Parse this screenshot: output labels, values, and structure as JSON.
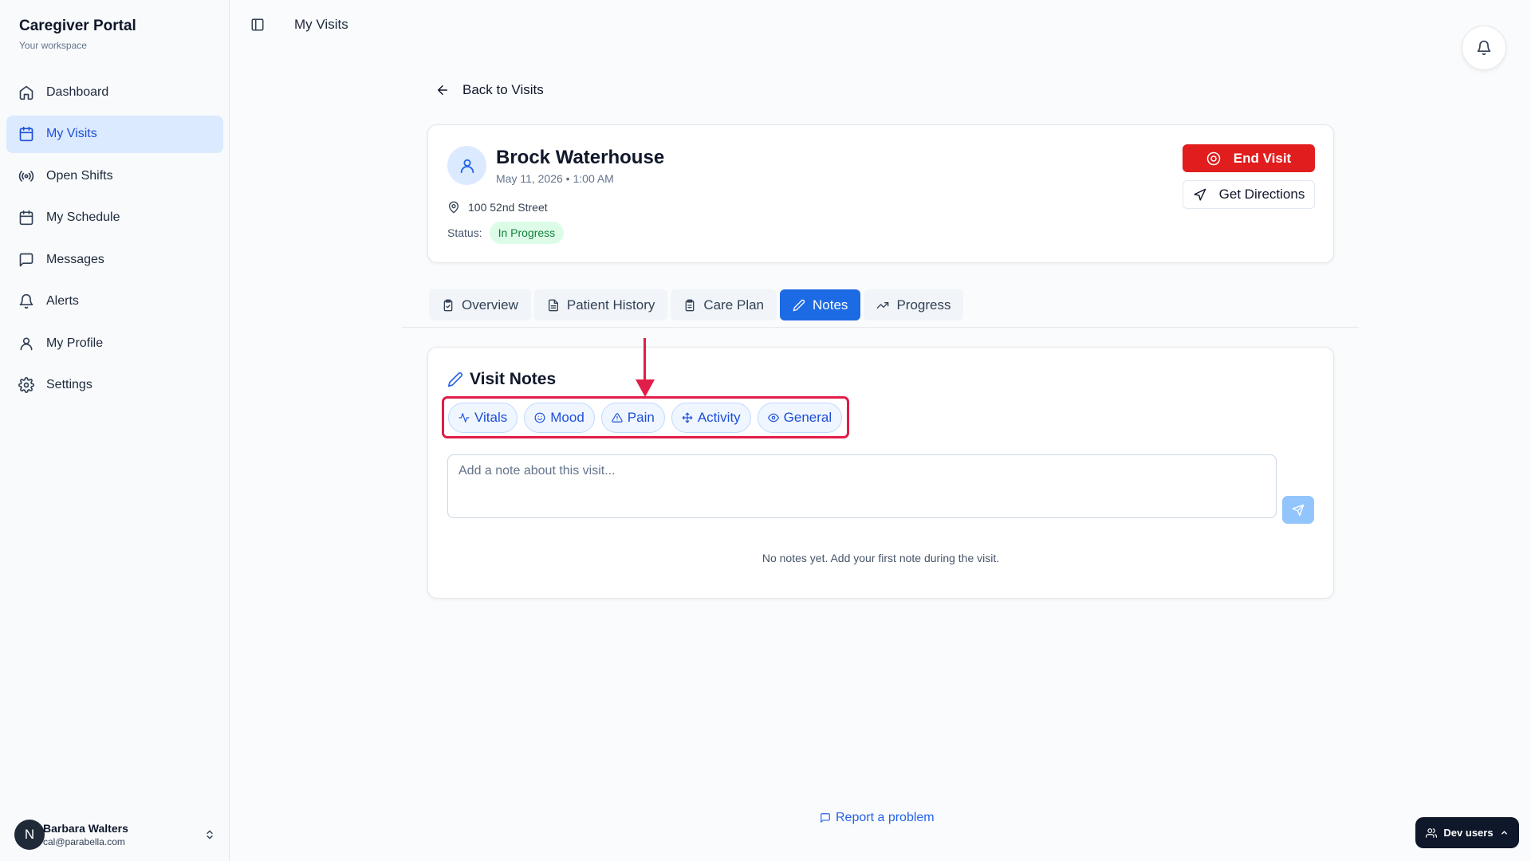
{
  "sidebar": {
    "title": "Caregiver Portal",
    "subtitle": "Your workspace",
    "items": [
      {
        "label": "Dashboard",
        "icon": "home-icon"
      },
      {
        "label": "My Visits",
        "icon": "calendar-icon",
        "active": true
      },
      {
        "label": "Open Shifts",
        "icon": "broadcast-icon"
      },
      {
        "label": "My Schedule",
        "icon": "calendar-icon"
      },
      {
        "label": "Messages",
        "icon": "message-icon"
      },
      {
        "label": "Alerts",
        "icon": "bell-icon"
      },
      {
        "label": "My Profile",
        "icon": "user-icon"
      },
      {
        "label": "Settings",
        "icon": "gear-icon"
      }
    ],
    "user": {
      "initial": "N",
      "name": "Barbara Walters",
      "email": "cal@parabella.com"
    }
  },
  "header": {
    "title": "My Visits"
  },
  "back_link": "Back to Visits",
  "visit": {
    "patient_name": "Brock Waterhouse",
    "datetime": "May 11, 2026 • 1:00 AM",
    "address": "100 52nd Street",
    "status_label": "Status:",
    "status": "In Progress",
    "end_visit_label": "End Visit",
    "directions_label": "Get Directions"
  },
  "tabs": [
    {
      "label": "Overview",
      "icon": "clipboard-icon"
    },
    {
      "label": "Patient History",
      "icon": "document-icon"
    },
    {
      "label": "Care Plan",
      "icon": "clipboard-list-icon"
    },
    {
      "label": "Notes",
      "icon": "pencil-icon",
      "active": true
    },
    {
      "label": "Progress",
      "icon": "trending-up-icon"
    }
  ],
  "notes": {
    "title": "Visit Notes",
    "chips": [
      {
        "label": "Vitals",
        "icon": "activity-icon"
      },
      {
        "label": "Mood",
        "icon": "smile-icon"
      },
      {
        "label": "Pain",
        "icon": "alert-triangle-icon"
      },
      {
        "label": "Activity",
        "icon": "move-icon"
      },
      {
        "label": "General",
        "icon": "eye-icon"
      }
    ],
    "input_placeholder": "Add a note about this visit...",
    "input_value": "",
    "empty_text": "No notes yet. Add your first note during the visit."
  },
  "footer": {
    "report_label": "Report a problem",
    "dev_label": "Dev users"
  },
  "colors": {
    "accent": "#1d6ae5",
    "danger": "#e11d1d",
    "success_bg": "#dcfce7",
    "success_text": "#15803d",
    "annotation": "#e11d48"
  }
}
